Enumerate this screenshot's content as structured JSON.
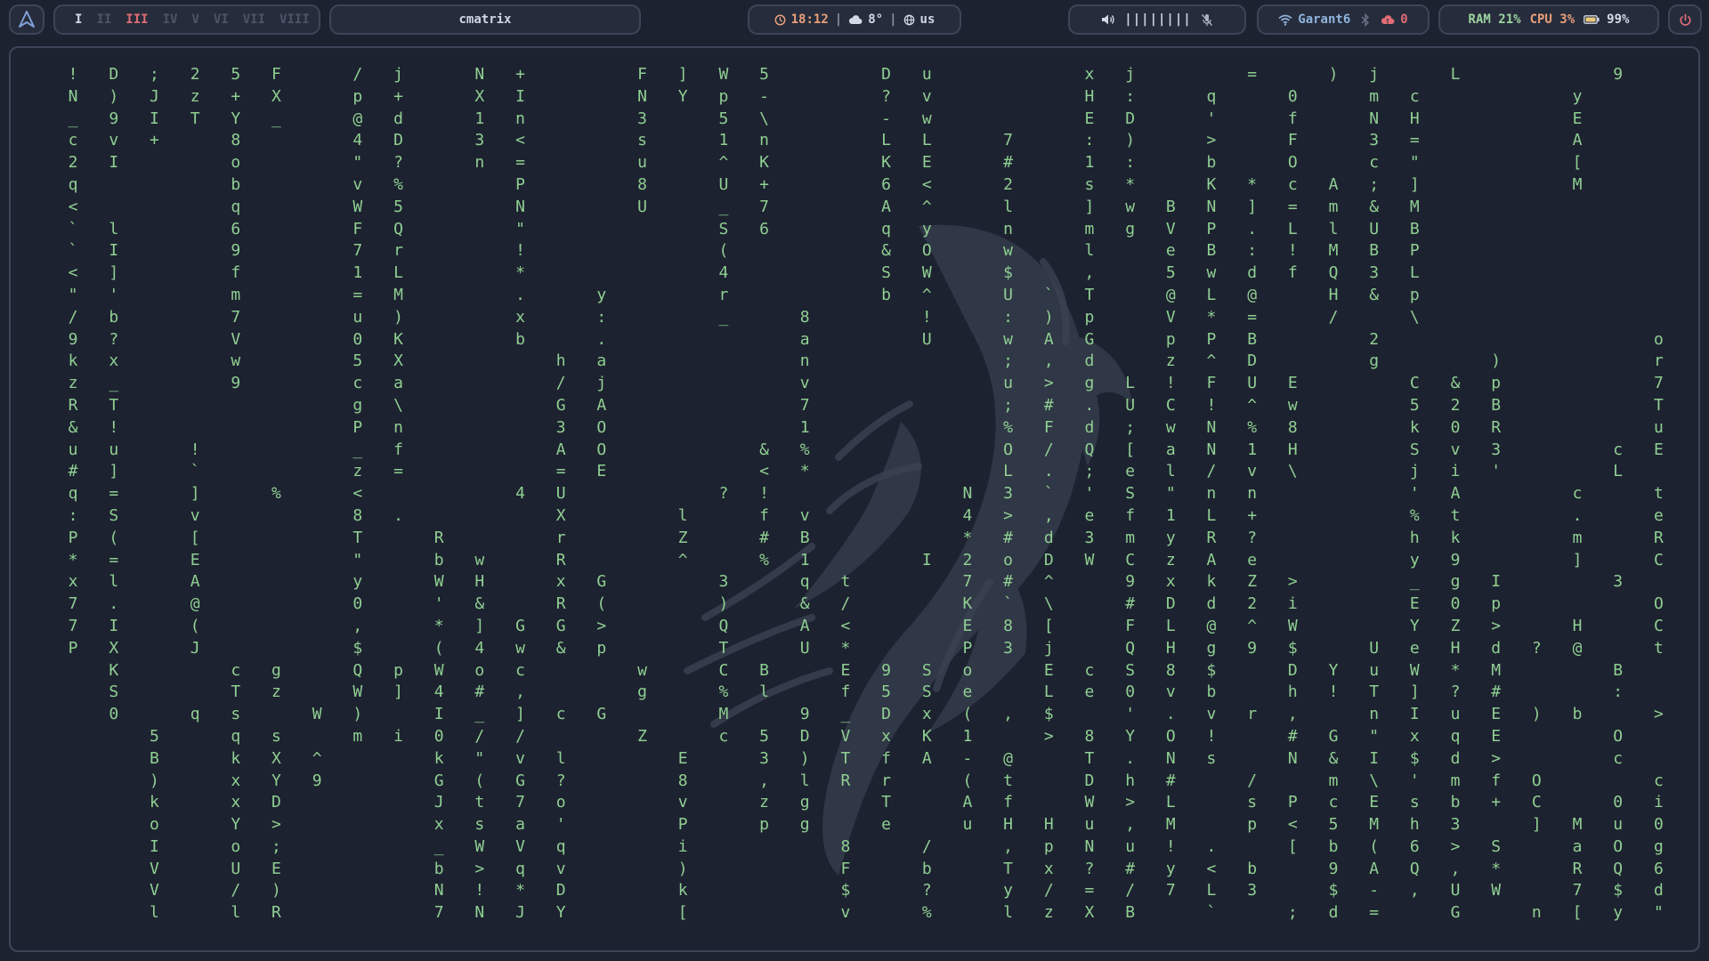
{
  "bar": {
    "launcher": "launcher-icon",
    "workspaces": [
      {
        "label": "I",
        "state": "occupied"
      },
      {
        "label": "II",
        "state": "empty"
      },
      {
        "label": "III",
        "state": "active"
      },
      {
        "label": "IV",
        "state": "empty"
      },
      {
        "label": "V",
        "state": "empty"
      },
      {
        "label": "VI",
        "state": "empty"
      },
      {
        "label": "VII",
        "state": "empty"
      },
      {
        "label": "VIII",
        "state": "empty"
      }
    ],
    "window_title": "cmatrix",
    "clock": {
      "time": "18:12",
      "temperature": "8°",
      "keyboard_layout": "us"
    },
    "audio": {
      "volume_bar": "||||||||",
      "volume_level": 0.8
    },
    "network": {
      "ssid": "Garant6",
      "vpn_count": "0"
    },
    "system": {
      "ram": "RAM 21%",
      "cpu": "CPU 3%",
      "battery": "99%"
    }
  },
  "colors": {
    "background": "#1d2230",
    "pill_background": "#262c3b",
    "pill_border": "#3d4558",
    "matrix_text": "#8fcf92",
    "active_workspace": "#e06c75",
    "clock_accent": "#e8a07a",
    "network_text": "#8fb3dc",
    "ram_text": "#9ed3a0"
  },
  "terminal": {
    "app": "cmatrix",
    "matrix_text": "  ! D ; 2 5 F   / j   N +     F ] W 5     D u       x j     =   ) j   L       9       I     F * ]   9     & u =     l   & \" >     g z j l b N w       ,     !     O  \n  N ) J z + X   p +   X I     N Y p -     ? v       H :   q   0   m c       y       O   - ' /     9   n D p     \"   . m v     C J Y h s k m   Q   n             X  \n  _ 9 I T Y _   @ d   1 n     3   5 \\     - w       E D   '   f   N H       E       N   p 5 (         ^ Q X     )   q 2 X     O m 0 ! v E 6     f       C   k   i\n  c v +   8     4 D   3 <     s   1 n     L L   7   : )   >   F   3 =       A       d   E 4 ,         D A 8     T   + E :     f 8 k T @ ? 3     t       b   0   1\n  2 I     o     \" ?   n =     u   ^ K     K E   #   1 :   b   O   c \"       [       :   & @ Z     C * ! , S     3   s a `     G 0 6 Y 6 9 a     ( Y       I   5   %\n  q       b     v %     P     8   U +     6 <   2   s *   K * c A ; ]       M           _ ^       Y K 1 5 2     R   T . z     Y Y W f [ ! M     X \"       V   $ J 7\n  <       q     W 5     N     U   _ 7     A ^   l   ] w B N ] = m & M                   ; n       % 3 Y B #     O   q P       U X * . Y F d     < C       n   i j ^\n  ` l     6     F Q     \"         S 6     q y   n   m g V P . L l U B                     R       W : 8 o `     v   $ T       y J / A >         $ (       3 L ] L l c\n  ` I     9     7 r     !         (       & O   w   l   e B : ! M B P                     n       l s F F ]     g   H e         P x   3       i =       4 > . G ) J\n  < ]     f     1 L     *         4       S W   $   ,   5 w d f Q 3 L                     S       $ o s h f     )   8   l       0     0       Q e       C r f J ^ /\n  \" '     m     = M     .   y     r       b ^   U ` T   @ L @   H & p             s   [       ( 6 N I 2     ;   ;   e       O     -       s p     \" 9 n B J   h\n  / b     7     u )     x   :     _   8     !   : ) p   V * =   /   \\             P L   # z       ; = ! ` b     u   `   9       E     \" F     j k     $ \" ` $ 8   S\n  9 ?     V     0 K     b   .         a     U   w A G   p P B     2             o 8   V b       + w i d $ f     t   M   o       ^     _ 1   P ) ,     B E t . !   r\n  k x     w     5 X       h a         n         ; , d   z ^ D     g     )       r =   < \"       7 D E Q 6     O   .   +       Y     ' @   1 - V /     . ] m y n   I\n  z _     9     c a       / j         v         u > g L ! F U E     C & p       7 6   x Z       # B . q 0     \\   f   9       n     i ,   * S $ @   h   R ! V   `\n  R T           g \\       G A         7         ; # . U C ! ^ w     5 2 B       T ?     Y       0 \" 9 $ 6     D   V 5 9       I     ' \\   o % L J   W   _ \" Q   b\n  & !           P n       3 O         1         % F d ; w N % 8     k 0 R       u j     (       & x = / P     I   8 y C       t     u a   @ Y   z   _   _ ^ k   B\n  u u   !       _ f       A O       & %         O / Q [ a N 1 H     S v 3     c E 7   T B     ! T _ N G     O   r > R       M     ; L   ' z   -   m   Q # `   K\n  # ]   `       z =       = E       < *         L . ; e l / v \\     j i '     L   W   q g     V B ; i T     n   - y _       n     R 4   I Y   4   S   A % w   k\n  q =   ]   %   <       4 U       ? !         N 3 ` ' S \" n n       ' A     c   t   s b     ) . k 0 i     z : t o S       Y     @ !   O !   p   =   V f E   @\n  : S   v       8 .       X     l   f v       4 > , e f 1 L +       % t     .   e   X u     _ \" g d x     E u p K K       9     V <   Y '   L   M   Q L d   Z\n  P (   [       T   R     r     Z   # B       * # d 3 m y R ?       h k     m   R   V e     < e N W u     w f s B /       &     n a   Z k   g   o ? R /   L\n  * =   E       \"   b w   R     ^   % 1     I 2 o D W C z A e       y 9     ]   C   -       + , v D _     + e \" 4 $       2     ` P   ] M   [   a   K k Q   4\n  x l   A       y   W H   x G     3   q t     7 # ^   9 x k Z >     _ g I     3   5   a       C _ E x K     . D J ^ C       r       A   X s   L   Z   t F y   U\n  7 .   @       0   ' &   R (     )   & /     K ` \\   # D d 2 i     E 0 p       O   c       0 Y ; ! &     + < c . E       =       h & V 9   t   T   T Q f   z\n  7 I   (       ,   * ] G G >     Q   A <     E 8 [   F L @ ^ W     Y Z >   H   C   o       e 3 [ \" #     R Z c _ [       ; K     b : 9 B   O   '   ^   X   /\n  P X   J       $   ( 4 w & p     T   U *     P 3 j   Q H g 9 $   U e H d ? @   t   _         d A ( V     I v k c T       U 5     [ Q ; K   @   l   T   E   m\n    K     c g   Q p W o c     w   C B   E 9 S o   E c S 8 $   D Y u W * M     B     H 4       ? 9 , a     y 3 L / %       Q \\     2 5 Y ]   3   J   8   b  \n    S     T z   W ] 4 # ,     g   % l   f 5 S e   L e 0 v b   h ! T ] ? #     :     C W o         r   r     $ 9   # J         7       ( 8 k o   8   >   s   )  \n    0   q s   W )   I _ ] c G     M   9 _ D x ( , $   ' . v r ,   n I u E ) b   >   + g f         x         V x   7 > t       C       h 4 y =   1 7 6   g   /  \n      5   q s   m i 0 / /     Z   c 5 D V x K 1   > 8 Y O !   # G \" x q E     O   B I 4       @ m       7 5   N + T       3       O + I #   \\ & ^   .   ^ %\n      B   k X ^     k \" v l     E   3 ) T f A - @   T . N s   N & I $ d >     c   & p S       Y `       y s   ? B #       S       ; N J 3   c p     `   \" 0\n      )   x Y 9     G ( G ?     8   , l R r   ( t   D h #   /   m \\ ' m f O     c   f Q 0       ) \\     \\ / A r R b U       d       u R p a   & g   \" 2 $   h\n      k   x D       J t 7 o     v   z g   T   A f   W > L   s P c E s b + C   0 i = t k J       g y       U + o k , N h       /       1 Z P 3     G   b @ >   `\n      o   Y >       x s a '     P   p g   e   u H H u , M   p < 5 M h 3   ] M u 0 ; k N C       O n       ` \" n 7 ^   & K       ?       3 P l t     d   W e >   l\n      I   o ;       _ W V q     i       8   /   , p N u ! .   [ b ( 6 > S   a O g y k u k !       G 9       Q ` m 7 !   , 1       8       y r \\ T     X   L   D   s\n      V   U E       b > q v     )       F   b   T x ? # y < b   9 A Q , *   R Q 6 m A u W M       a =       J   h . 4   b 4       -       < U = !     z   0   C   [\n      V   / )       N ! * D     k       $   ?   y / = / 7 L 3   $ - , U W   7 $ d ( c A O =       J         D   N   j   3 m       g       Q . N P     l   H   d S *\n      l   l R       7 N J Y     [       v   %   l z X B   `   ; d =   G   n [ y \" = ] \\ 5       M   4     W   s   &   G E       f       q u ? :     l   4   ` k U  "
  }
}
